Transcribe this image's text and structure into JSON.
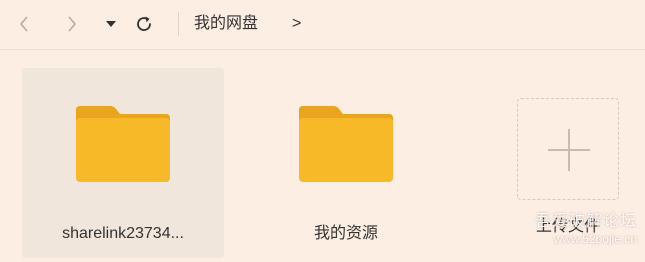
{
  "toolbar": {
    "breadcrumb": "我的网盘",
    "breadcrumb_separator": ">"
  },
  "items": [
    {
      "type": "folder",
      "name": "sharelink23734...",
      "selected": true
    },
    {
      "type": "folder",
      "name": "我的资源",
      "selected": false
    }
  ],
  "upload": {
    "label": "上传文件",
    "icon": "plus-icon"
  },
  "watermark": {
    "line1": "吾爱破解论坛",
    "line2": "www.52pojie.cn"
  },
  "colors": {
    "background": "#fdeee4",
    "folder": "#f7b928",
    "folder_tab": "#e9a51e",
    "selected_tile": "#f1e6dc"
  }
}
